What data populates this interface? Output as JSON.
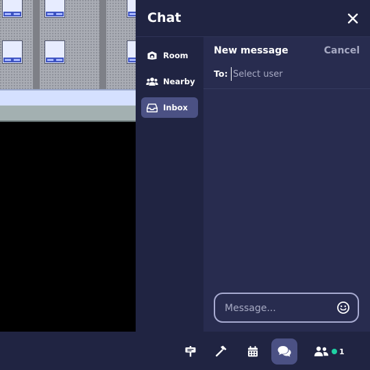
{
  "chat": {
    "title": "Chat",
    "nav": [
      {
        "label": "Room",
        "icon": "room-icon"
      },
      {
        "label": "Nearby",
        "icon": "users-icon"
      },
      {
        "label": "Inbox",
        "icon": "inbox-icon",
        "active": true
      }
    ],
    "compose": {
      "title": "New message",
      "cancel_label": "Cancel",
      "to_label": "To:",
      "to_placeholder": "Select user",
      "message_placeholder": "Message..."
    }
  },
  "toolbar": {
    "buttons": [
      {
        "icon": "signpost-icon"
      },
      {
        "icon": "hammer-icon"
      },
      {
        "icon": "calendar-icon"
      },
      {
        "icon": "chat-icon",
        "active": true
      },
      {
        "icon": "participants-icon"
      }
    ],
    "online_count": "1"
  },
  "colors": {
    "panel_bg": "#262a4a",
    "sidebar_bg": "#202442",
    "active_bg": "#4b5184",
    "online": "#1fd1a4"
  }
}
